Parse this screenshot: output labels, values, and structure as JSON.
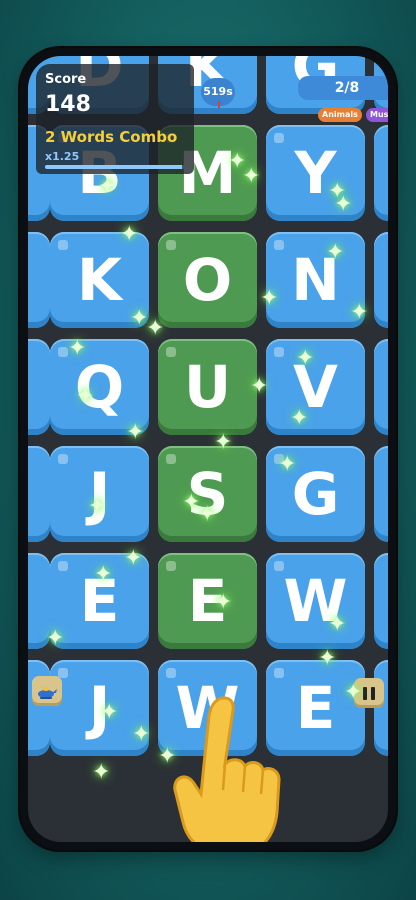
{
  "hud": {
    "score_label": "Score",
    "score_value": "148",
    "combo_text": "2 Words Combo",
    "multiplier": "x1.25",
    "combo_progress": 0.95,
    "timer": "519s",
    "progress": "2/8",
    "tags": [
      "Animals",
      "Music"
    ]
  },
  "board": {
    "columns_visible": 3,
    "rows": [
      {
        "letters": [
          "D",
          "K",
          "G"
        ],
        "selected": [
          false,
          false,
          false
        ]
      },
      {
        "letters": [
          "B",
          "M",
          "Y"
        ],
        "selected": [
          false,
          true,
          false
        ]
      },
      {
        "letters": [
          "K",
          "O",
          "N"
        ],
        "selected": [
          false,
          true,
          false
        ]
      },
      {
        "letters": [
          "Q",
          "U",
          "V"
        ],
        "selected": [
          false,
          true,
          false
        ]
      },
      {
        "letters": [
          "J",
          "S",
          "G"
        ],
        "selected": [
          false,
          true,
          false
        ]
      },
      {
        "letters": [
          "E",
          "E",
          "W"
        ],
        "selected": [
          false,
          true,
          false
        ]
      },
      {
        "letters": [
          "J",
          "W",
          "E"
        ],
        "selected": [
          false,
          false,
          false
        ]
      }
    ]
  },
  "controls": {
    "hint_icon": "genie-lamp-icon",
    "pause_icon": "pause-icon"
  },
  "overlay": {
    "hand_icon": "pointing-hand-icon",
    "sparkle_icon": "sparkle-icon"
  },
  "colors": {
    "tile": "#4aa2ea",
    "tile_selected": "#4f9a52",
    "combo_text": "#f3cf3b",
    "progress_pill": "#3f8ad8"
  }
}
